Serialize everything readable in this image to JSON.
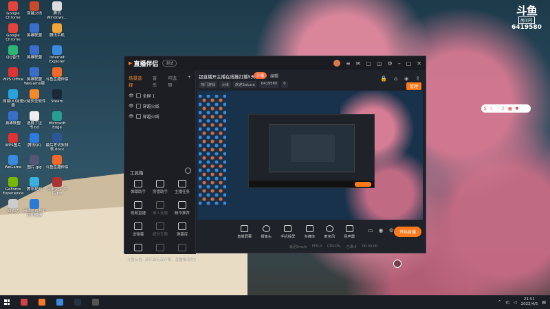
{
  "desktop": {
    "icons": [
      {
        "label": "Google Chrome",
        "color": "#e3433a"
      },
      {
        "label": "穿越火线",
        "color": "#c94a2a"
      },
      {
        "label": "腾讯 Windows...",
        "color": "#ddd"
      },
      {
        "label": "Google Chrome",
        "color": "#e3433a"
      },
      {
        "label": "英雄联盟",
        "color": "#3a6ec9"
      },
      {
        "label": "腾讯手机",
        "color": "#f2a53a"
      },
      {
        "label": "QQ音乐",
        "color": "#2bb673"
      },
      {
        "label": "英雄联盟",
        "color": "#3a6ec9"
      },
      {
        "label": "Internet Explorer",
        "color": "#3a8be0"
      },
      {
        "label": "WPS Office",
        "color": "#d33"
      },
      {
        "label": "英雄联盟 WeGame版",
        "color": "#3a6ec9"
      },
      {
        "label": "斗鱼直播伴侣",
        "color": "#f06a2a"
      },
      {
        "label": "网易UU加速器",
        "color": "#29a3e0"
      },
      {
        "label": "火绒安全软件",
        "color": "#f28a2a"
      },
      {
        "label": "Steam",
        "color": "#1b2838"
      },
      {
        "label": "英雄联盟",
        "color": "#3a6ec9"
      },
      {
        "label": "选择了证书.txt",
        "color": "#eee"
      },
      {
        "label": "Microsoft Edge",
        "color": "#2a9d8f"
      },
      {
        "label": "WPS图片",
        "color": "#d33"
      },
      {
        "label": "腾讯QQ",
        "color": "#2b7be0"
      },
      {
        "label": "最后考试安排 表.docx",
        "color": "#2b5797"
      },
      {
        "label": "WeGame",
        "color": "#3a8be0"
      },
      {
        "label": "图片.jpg",
        "color": "#557"
      },
      {
        "label": "斗鱼直播伴侣",
        "color": "#f06a2a"
      },
      {
        "label": "GeForce Experience",
        "color": "#76b900"
      },
      {
        "label": "腾讯视频",
        "color": "#3ab0e0"
      },
      {
        "label": "实用文件 文件.rar",
        "color": "#a33"
      },
      {
        "label": "回收站",
        "color": "#ccc"
      },
      {
        "label": "网络游戏与IP 打印编辑",
        "color": "#2a7ad8"
      }
    ],
    "watermark": {
      "logo": "斗鱼",
      "sub": "房间号",
      "room": "6419580"
    }
  },
  "window": {
    "brand": "直播伴侣",
    "badge": "测试",
    "sidebar_tabs": [
      "场景选择",
      "音乐",
      "可选项"
    ],
    "scenes": [
      "全屏 1",
      "穿越火线",
      "穿越火线"
    ],
    "tools_title": "工具箱",
    "tools": [
      {
        "label": "弹幕助手",
        "dim": false
      },
      {
        "label": "房管助手",
        "dim": false
      },
      {
        "label": "主播任务",
        "dim": false
      },
      {
        "label": "视频直播",
        "dim": false
      },
      {
        "label": "录入无限",
        "dim": true
      },
      {
        "label": "精华推荐",
        "dim": false
      },
      {
        "label": "送弹幕",
        "dim": false
      },
      {
        "label": "超时无限",
        "dim": true
      },
      {
        "label": "弹幕库",
        "dim": false
      },
      {
        "label": "",
        "dim": false
      },
      {
        "label": "",
        "dim": true
      },
      {
        "label": "",
        "dim": true
      }
    ],
    "header": {
      "title": "超直播开主播在线推打播5天",
      "tag": "开播",
      "edit": "编辑",
      "chips": [
        "热门游戏",
        "火线",
        "欢迎Sakura",
        "6419580",
        "0"
      ],
      "button": "管理"
    },
    "controls": [
      "直播屏幕",
      "摄像头",
      "手机投屏",
      "多媒体",
      "麦克风",
      "扬声器"
    ],
    "live_button": "开始直播",
    "notice": "斗鱼公告: 请开启无双开聊，直播推流在线，禁止一切恶意营销行为",
    "status": [
      "延迟0ms/s",
      "FPS:0",
      "CPU:0%",
      "已录:0",
      "00:00:00"
    ]
  },
  "taskbar": {
    "time": "21:51",
    "date": "2022/4/5"
  }
}
